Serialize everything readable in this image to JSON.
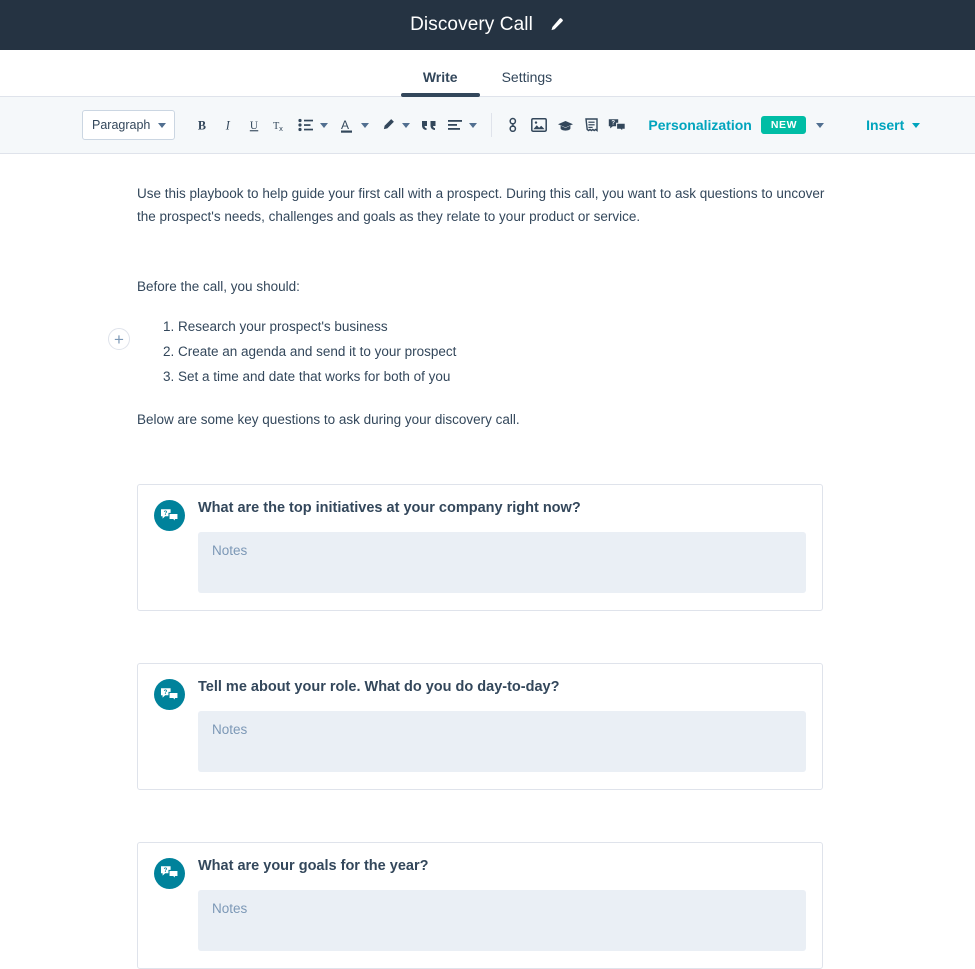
{
  "header": {
    "title": "Discovery Call",
    "edit_icon": "pencil-icon",
    "background": "#253342"
  },
  "tabs": [
    {
      "label": "Write",
      "active": true
    },
    {
      "label": "Settings",
      "active": false
    }
  ],
  "toolbar": {
    "paragraph_select": {
      "value": "Paragraph",
      "caret_icon": "chevron-down-icon"
    },
    "buttons": [
      {
        "name": "bold-button",
        "icon": "bold-icon",
        "label": "B"
      },
      {
        "name": "italic-button",
        "icon": "italic-icon",
        "label": "I"
      },
      {
        "name": "underline-button",
        "icon": "underline-icon",
        "label": "U"
      },
      {
        "name": "clear-formatting-button",
        "icon": "clear-formatting-icon",
        "label": "Tx"
      },
      {
        "name": "list-button",
        "icon": "bulleted-list-icon",
        "label": ""
      },
      {
        "name": "text-color-button",
        "icon": "text-color-icon",
        "label": "A"
      },
      {
        "name": "highlight-button",
        "icon": "highlighter-icon",
        "label": ""
      },
      {
        "name": "blockquote-button",
        "icon": "quote-icon",
        "label": ""
      },
      {
        "name": "align-button",
        "icon": "align-left-icon",
        "label": ""
      },
      {
        "name": "link-button",
        "icon": "link-icon",
        "label": ""
      },
      {
        "name": "image-button",
        "icon": "image-icon",
        "label": ""
      },
      {
        "name": "knowledge-button",
        "icon": "graduation-cap-icon",
        "label": ""
      },
      {
        "name": "snippet-button",
        "icon": "document-icon",
        "label": ""
      },
      {
        "name": "question-button",
        "icon": "question-bubble-icon",
        "label": ""
      }
    ],
    "personalization": {
      "label": "Personalization",
      "badge": "NEW",
      "badge_color": "#00bda5",
      "accent_color": "#00a4bd"
    },
    "insert": {
      "label": "Insert",
      "accent_color": "#00a4bd"
    },
    "background": "#f5f8fa"
  },
  "document": {
    "add_block_icon": "plus-icon",
    "intro": "Use this playbook to help guide your first call with a prospect. During this call, you want to ask questions to uncover the prospect's needs, challenges and goals as they relate to your product or service.",
    "before_call_heading": "Before the call, you should:",
    "steps": [
      "Research your prospect's business",
      "Create an agenda and send it to your prospect",
      "Set a time and date that works for both of you"
    ],
    "closing": "Below are some key questions to ask during your discovery call.",
    "questions": [
      {
        "icon": "question-bubble-icon",
        "title": "What are the top initiatives at your company right now?",
        "notes_placeholder": "Notes",
        "notes_value": ""
      },
      {
        "icon": "question-bubble-icon",
        "title": "Tell me about your role. What do you do day-to-day?",
        "notes_placeholder": "Notes",
        "notes_value": ""
      },
      {
        "icon": "question-bubble-icon",
        "title": "What are your goals for the year?",
        "notes_placeholder": "Notes",
        "notes_value": ""
      }
    ]
  },
  "colors": {
    "header_bg": "#253342",
    "toolbar_bg": "#f5f8fa",
    "text": "#33475b",
    "teal": "#00a4bd",
    "icon_circle": "#00829b",
    "notes_bg": "#eaeff5",
    "border": "#dfe3eb"
  }
}
